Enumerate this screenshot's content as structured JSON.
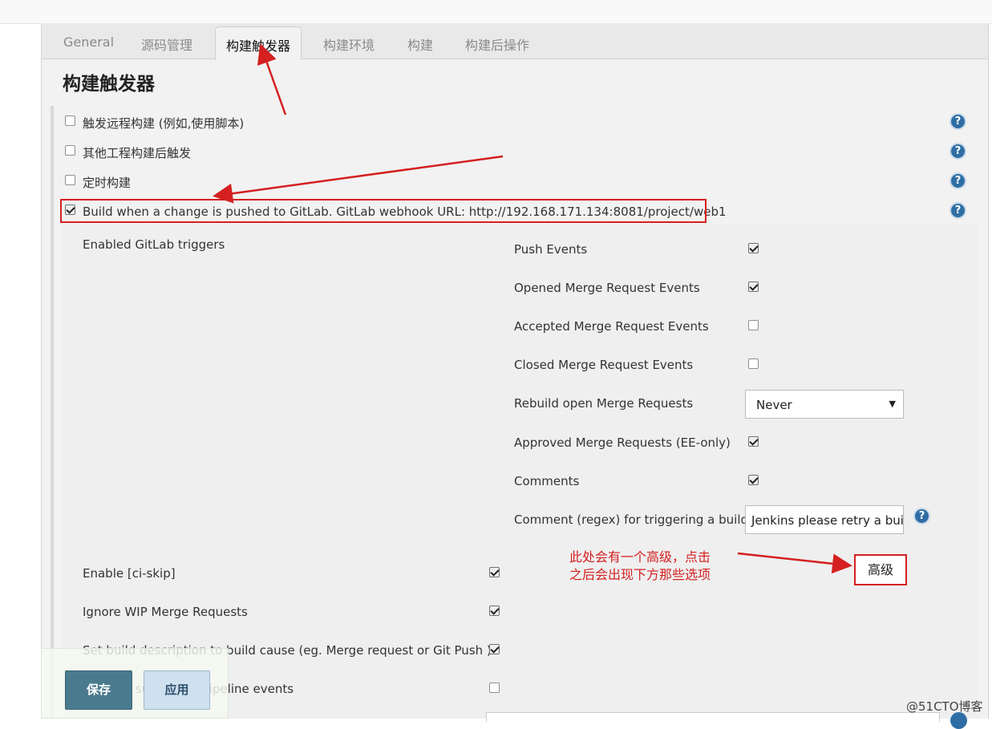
{
  "tabs": [
    "General",
    "源码管理",
    "构建触发器",
    "构建环境",
    "构建",
    "构建后操作"
  ],
  "active_tab": "构建触发器",
  "section_title": "构建触发器",
  "triggers": [
    {
      "label": "触发远程构建 (例如,使用脚本)",
      "checked": false
    },
    {
      "label": "其他工程构建后触发",
      "checked": false
    },
    {
      "label": "定时构建",
      "checked": false
    },
    {
      "label": "Build when a change is pushed to GitLab. GitLab webhook URL: http://192.168.171.134:8081/project/web1",
      "checked": true
    }
  ],
  "gitlab": {
    "enabled_triggers_label": "Enabled GitLab triggers",
    "events": [
      {
        "label": "Push Events",
        "checked": true
      },
      {
        "label": "Opened Merge Request Events",
        "checked": true
      },
      {
        "label": "Accepted Merge Request Events",
        "checked": false
      },
      {
        "label": "Closed Merge Request Events",
        "checked": false
      }
    ],
    "rebuild": {
      "label": "Rebuild open Merge Requests",
      "value": "Never"
    },
    "approved": {
      "label": "Approved Merge Requests (EE-only)",
      "checked": true
    },
    "comments": {
      "label": "Comments",
      "checked": true
    },
    "comment_regex": {
      "label": "Comment (regex) for triggering a build",
      "value": "Jenkins please retry a build"
    },
    "advanced_label": "高级",
    "options": [
      {
        "label": "Enable [ci-skip]",
        "checked": true
      },
      {
        "label": "Ignore WIP Merge Requests",
        "checked": true
      },
      {
        "label": "Set build description to build cause (eg. Merge request or Git Push )",
        "checked": true
      },
      {
        "label": "Build on successful pipeline events",
        "checked": false
      }
    ]
  },
  "annotation": {
    "line1": "此处会有一个高级，点击",
    "line2": "之后会出现下方那些选项"
  },
  "buttons": {
    "save": "保存",
    "apply": "应用"
  },
  "watermark": "@51CTO博客",
  "colors": {
    "annotation_red": "#d42020",
    "save_button": "#4a7a8d",
    "help_icon": "#2f6ea4"
  }
}
